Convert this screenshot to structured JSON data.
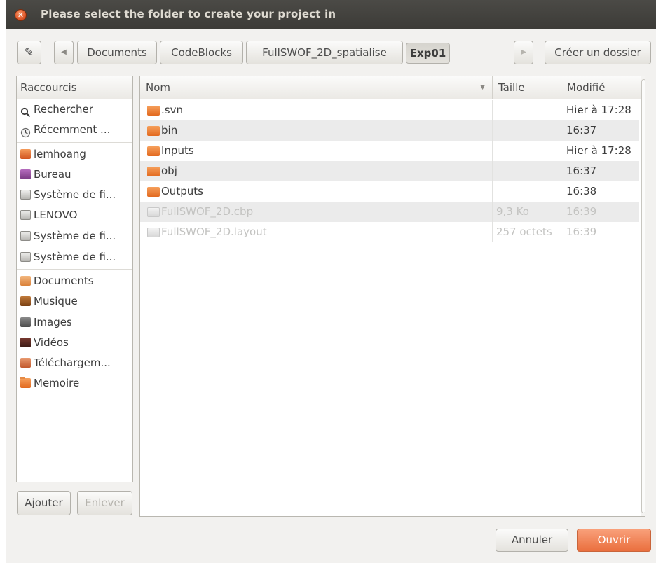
{
  "window": {
    "title": "Please select the folder to create your project in"
  },
  "pathbar": {
    "segments": [
      "Documents",
      "CodeBlocks",
      "FullSWOF_2D_spatialise",
      "Exp01"
    ],
    "active_segment": "Exp01",
    "create_folder_label": "Créer un dossier"
  },
  "places": {
    "header": "Raccourcis",
    "items": [
      {
        "label": "Rechercher",
        "icon": "search-icon"
      },
      {
        "label": "Récemment ...",
        "icon": "recent-icon"
      },
      {
        "label": "lemhoang",
        "icon": "home-folder-icon"
      },
      {
        "label": "Bureau",
        "icon": "desktop-icon"
      },
      {
        "label": "Système de fi...",
        "icon": "drive-icon"
      },
      {
        "label": "LENOVO",
        "icon": "drive-icon"
      },
      {
        "label": "Système de fi...",
        "icon": "drive-icon"
      },
      {
        "label": "Système de fi...",
        "icon": "drive-icon"
      },
      {
        "label": "Documents",
        "icon": "documents-icon"
      },
      {
        "label": "Musique",
        "icon": "music-icon"
      },
      {
        "label": "Images",
        "icon": "images-icon"
      },
      {
        "label": "Vidéos",
        "icon": "videos-icon"
      },
      {
        "label": "Téléchargem...",
        "icon": "downloads-icon"
      },
      {
        "label": "Memoire",
        "icon": "folder-icon"
      }
    ],
    "add_label": "Ajouter",
    "remove_label": "Enlever"
  },
  "files": {
    "columns": {
      "name": "Nom",
      "size": "Taille",
      "modified": "Modifié"
    },
    "rows": [
      {
        "name": ".svn",
        "size": "",
        "modified": "Hier à 17:28",
        "type": "folder"
      },
      {
        "name": "bin",
        "size": "",
        "modified": "16:37",
        "type": "folder"
      },
      {
        "name": "Inputs",
        "size": "",
        "modified": "Hier à 17:28",
        "type": "folder"
      },
      {
        "name": "obj",
        "size": "",
        "modified": "16:37",
        "type": "folder"
      },
      {
        "name": "Outputs",
        "size": "",
        "modified": "16:38",
        "type": "folder"
      },
      {
        "name": "FullSWOF_2D.cbp",
        "size": "9,3 Ko",
        "modified": "16:39",
        "type": "file"
      },
      {
        "name": "FullSWOF_2D.layout",
        "size": "257 octets",
        "modified": "16:39",
        "type": "file"
      }
    ]
  },
  "footer": {
    "cancel_label": "Annuler",
    "open_label": "Ouvrir"
  },
  "colors": {
    "titlebar": "#3c3b37",
    "accent": "#ea6f3e",
    "row_alt": "#ebebeb"
  }
}
